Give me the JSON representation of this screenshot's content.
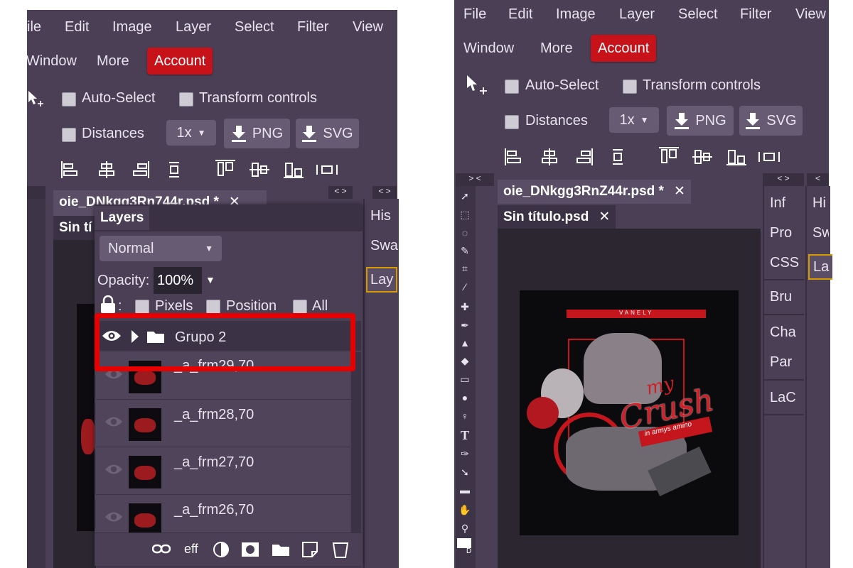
{
  "left": {
    "menu": [
      "ile",
      "Edit",
      "Image",
      "Layer",
      "Select",
      "Filter",
      "View",
      "Window",
      "More"
    ],
    "account": "Account",
    "options": {
      "auto_select": "Auto-Select",
      "transform": "Transform controls",
      "distances": "Distances",
      "scale": "1x",
      "png": "PNG",
      "svg": "SVG"
    },
    "strip_arrows": "< >",
    "doc_tab": "oie_DNkgg3Rn744r.psd *",
    "doc_tab_close": "✕",
    "doc_tab2": "Sin tí",
    "side_tabs": [
      "His",
      "Swa",
      "Lay"
    ],
    "layers_panel": {
      "title": "Layers",
      "blend_mode": "Normal",
      "opacity_label": "Opacity:",
      "opacity_value": "100%",
      "lock_colon": ":",
      "lock_options": [
        "Pixels",
        "Position",
        "All"
      ],
      "group_name": "Grupo 2",
      "layers": [
        "_a_frm29,70",
        "_a_frm28,70",
        "_a_frm27,70",
        "_a_frm26,70"
      ],
      "footer_eff": "eff"
    },
    "highlight_color": "#e60000"
  },
  "right": {
    "menu": [
      "File",
      "Edit",
      "Image",
      "Layer",
      "Select",
      "Filter",
      "View",
      "Window",
      "More"
    ],
    "account": "Account",
    "options": {
      "auto_select": "Auto-Select",
      "transform": "Transform controls",
      "distances": "Distances",
      "scale": "1x",
      "png": "PNG",
      "svg": "SVG"
    },
    "strip_arrows": "> <",
    "strip_arrows2": "< >",
    "strip_arrows3": "<",
    "doc_tabs": [
      "oie_DNkgg3RnZ44r.psd *",
      "Sin título.psd"
    ],
    "tab_close": "✕",
    "panel_tabs": [
      "Inf",
      "Pro",
      "CSS",
      "Bru",
      "Cha",
      "Par",
      "LaC"
    ],
    "panel_tabs2": [
      "Hi",
      "Sw",
      "La"
    ],
    "artwork": {
      "banner": "VANELY",
      "title_small": "my",
      "title_big": "Crush",
      "subtitle": "in armys amino"
    },
    "colors_label": "D"
  },
  "theme": {
    "panel": "#4a3f55",
    "accent": "#c8121a"
  }
}
